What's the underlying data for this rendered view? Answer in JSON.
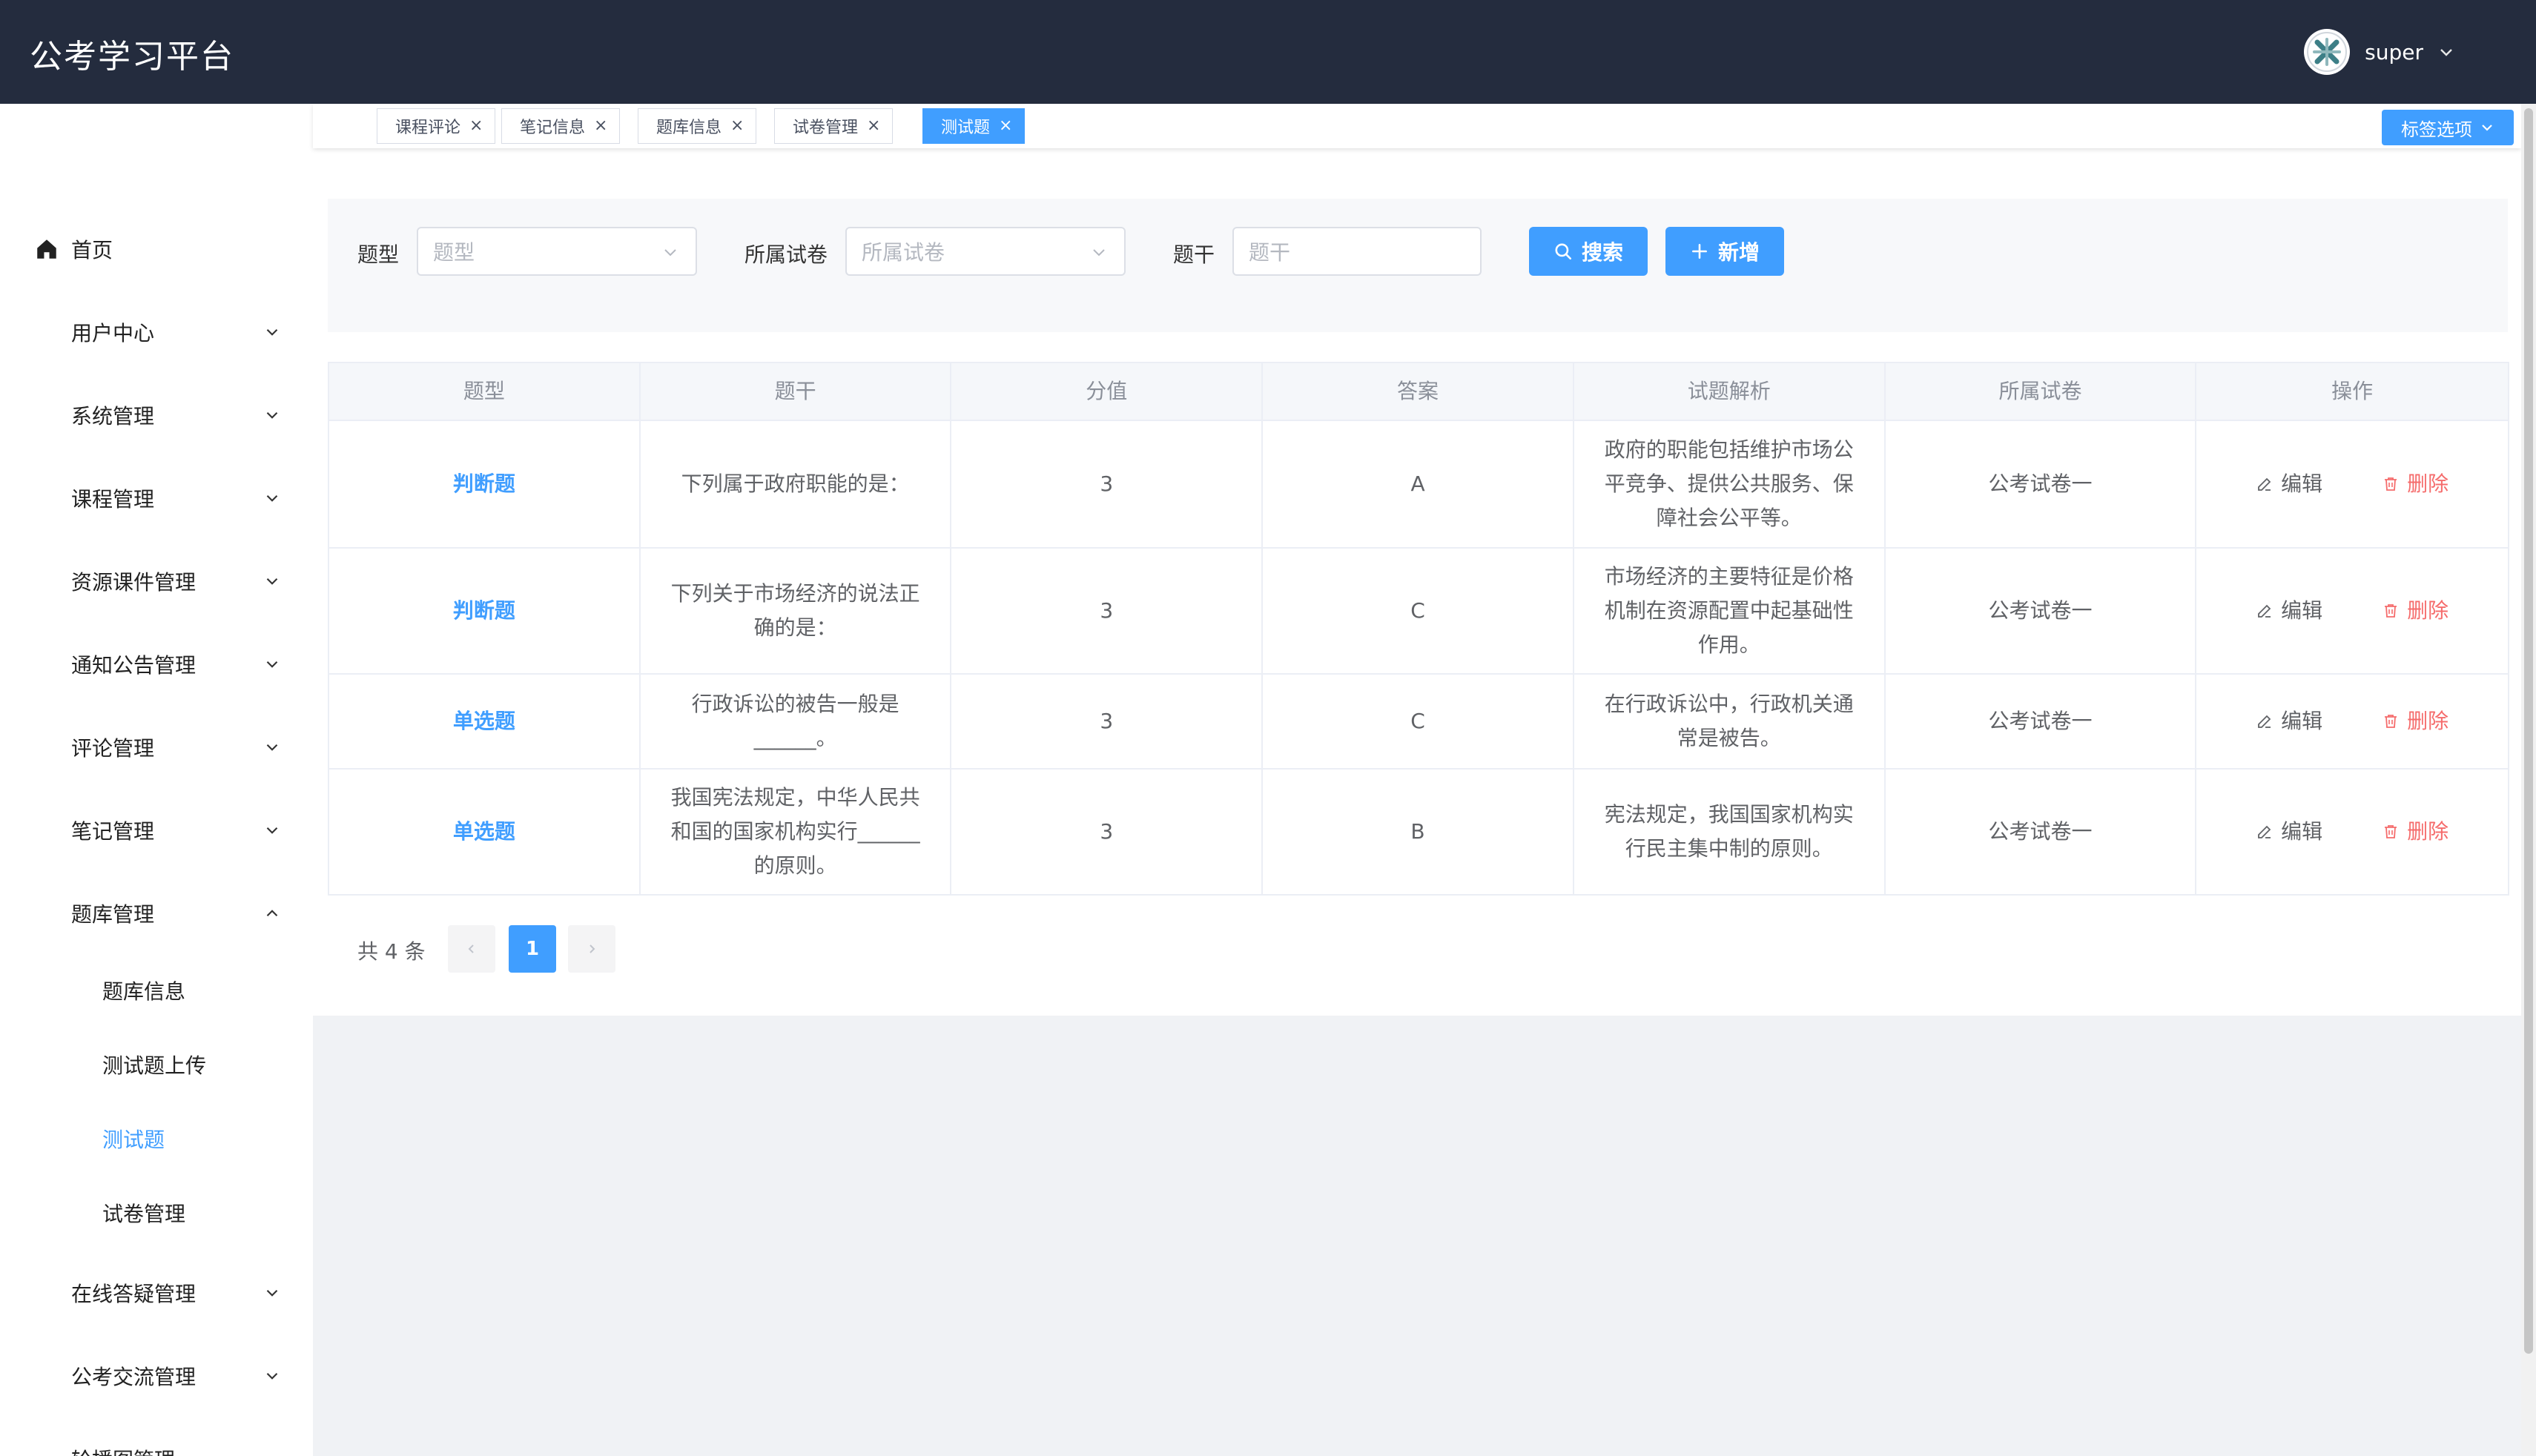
{
  "header": {
    "brand": "公考学习平台",
    "username": "super"
  },
  "sidebar": {
    "home": "首页",
    "items": [
      {
        "label": "用户中心"
      },
      {
        "label": "系统管理"
      },
      {
        "label": "课程管理"
      },
      {
        "label": "资源课件管理"
      },
      {
        "label": "通知公告管理"
      },
      {
        "label": "评论管理"
      },
      {
        "label": "笔记管理"
      },
      {
        "label": "题库管理"
      }
    ],
    "sub_items": [
      {
        "label": "题库信息"
      },
      {
        "label": "测试题上传"
      },
      {
        "label": "测试题"
      },
      {
        "label": "试卷管理"
      }
    ],
    "items_after": [
      {
        "label": "在线答疑管理"
      },
      {
        "label": "公考交流管理"
      },
      {
        "label": "轮播图管理"
      }
    ]
  },
  "tags": [
    {
      "label": "课程评论"
    },
    {
      "label": "笔记信息"
    },
    {
      "label": "题库信息"
    },
    {
      "label": "试卷管理"
    },
    {
      "label": "测试题"
    }
  ],
  "tag_options": "标签选项",
  "filters": {
    "type_label": "题型",
    "type_placeholder": "题型",
    "paper_label": "所属试卷",
    "paper_placeholder": "所属试卷",
    "stem_label": "题干",
    "stem_placeholder": "题干",
    "search_button": "搜索",
    "add_button": "新增"
  },
  "table": {
    "headers": [
      "题型",
      "题干",
      "分值",
      "答案",
      "试题解析",
      "所属试卷",
      "操作"
    ],
    "edit_label": "编辑",
    "delete_label": "删除",
    "rows": [
      {
        "type": "判断题",
        "stem": "下列属于政府职能的是：",
        "score": "3",
        "answer": "A",
        "analysis": "政府的职能包括维护市场公平竞争、提供公共服务、保障社会公平等。",
        "paper": "公考试卷一"
      },
      {
        "type": "判断题",
        "stem": "下列关于市场经济的说法正确的是：",
        "score": "3",
        "answer": "C",
        "analysis": "市场经济的主要特征是价格机制在资源配置中起基础性作用。",
        "paper": "公考试卷一"
      },
      {
        "type": "单选题",
        "stem": "行政诉讼的被告一般是______。",
        "score": "3",
        "answer": "C",
        "analysis": "在行政诉讼中，行政机关通常是被告。",
        "paper": "公考试卷一"
      },
      {
        "type": "单选题",
        "stem": "我国宪法规定，中华人民共和国的国家机构实行______的原则。",
        "score": "3",
        "answer": "B",
        "analysis": "宪法规定，我国国家机构实行民主集中制的原则。",
        "paper": "公考试卷一"
      }
    ]
  },
  "pagination": {
    "total": "共 4 条",
    "current": "1"
  }
}
